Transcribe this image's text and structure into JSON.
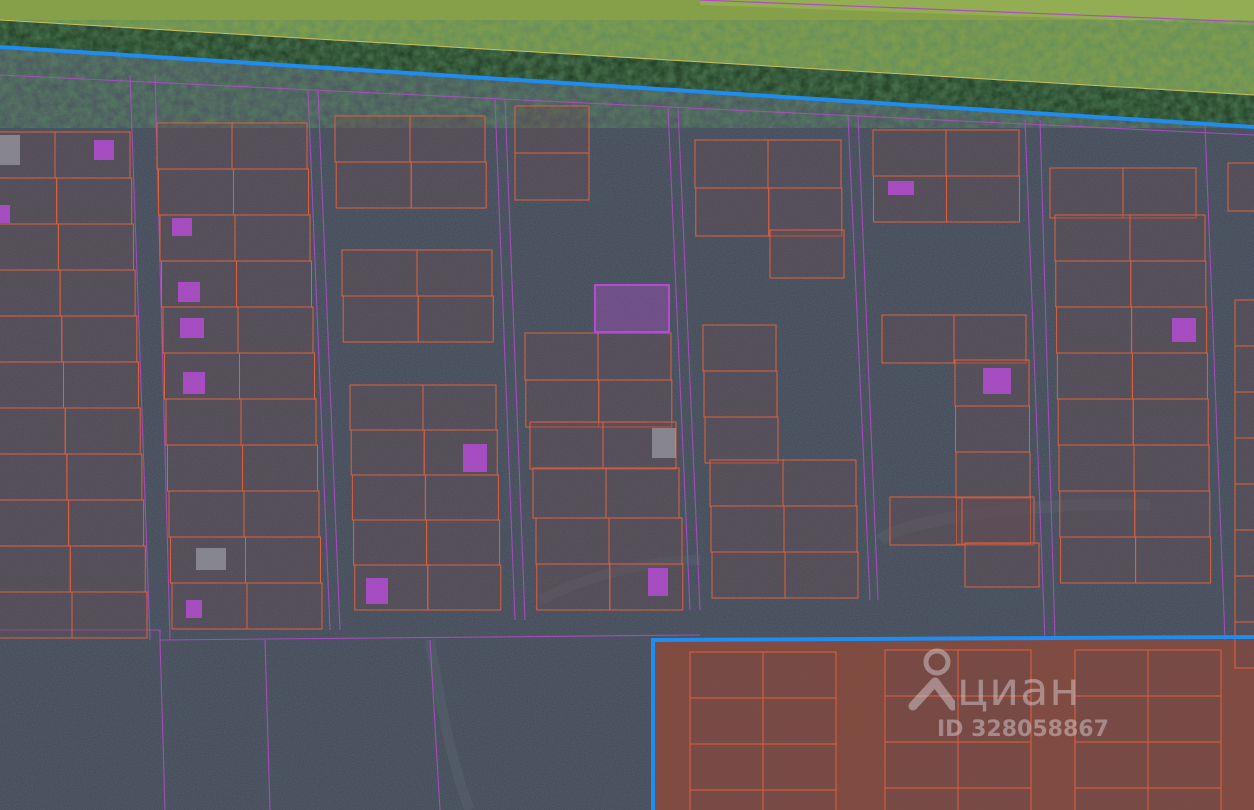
{
  "watermark": {
    "brand": "циан",
    "listing_id": "ID 328058867",
    "icon": "pin-person-icon"
  },
  "colors": {
    "field": "#86a04a",
    "treeline": "#1f3a22",
    "overlay": "#3e4656",
    "plot_line": "#e0603c",
    "parcel_line": "#b04cc4",
    "building": "#b44cd2",
    "boundary": "#1e8cf0",
    "highlight_fill": "#8a4a3c"
  }
}
